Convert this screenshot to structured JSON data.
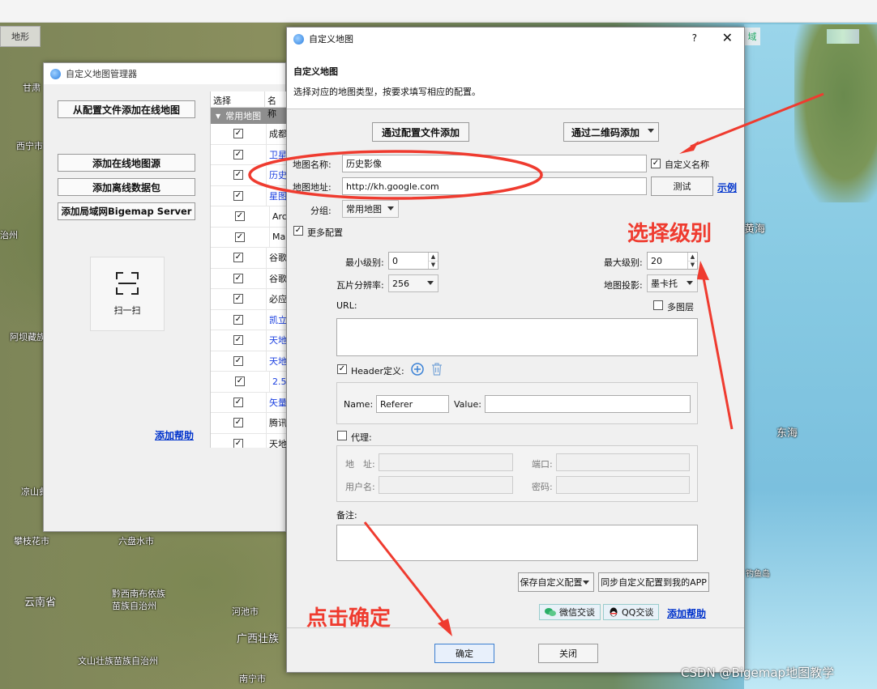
{
  "map": {
    "tab_left": "地形",
    "tab_right": "域",
    "labels": [
      {
        "text": "甘肃"
      },
      {
        "text": "西宁市"
      },
      {
        "text": "治州"
      },
      {
        "text": "阿坝藏族"
      },
      {
        "text": "凉山彝"
      },
      {
        "text": "攀枝花市"
      },
      {
        "text": "六盘水市"
      },
      {
        "text": "云南省"
      },
      {
        "text": "黔西南布依族苗族自治州"
      },
      {
        "text": "河池市"
      },
      {
        "text": "广西壮族"
      },
      {
        "text": "文山壮族苗族自治州"
      },
      {
        "text": "南宁市"
      },
      {
        "text": "黄海"
      },
      {
        "text": "东海"
      },
      {
        "text": "钓鱼岛"
      }
    ],
    "watermark": "CSDN @Bigemap地图教学"
  },
  "manager": {
    "title": "自定义地图管理器",
    "btn_add_from_config": "从配置文件添加在线地图",
    "btn_add_online": "添加在线地图源",
    "btn_add_offline": "添加离线数据包",
    "btn_add_lan": "添加局域网Bigemap Server",
    "scan_label": "扫一扫",
    "help_link": "添加帮助",
    "table": {
      "col_select": "选择",
      "col_name": "名称",
      "group": "常用地图",
      "rows": [
        {
          "name": "成都"
        },
        {
          "name": "卫星"
        },
        {
          "name": "历史"
        },
        {
          "name": "星图"
        },
        {
          "name": "Arc"
        },
        {
          "name": "Ma"
        },
        {
          "name": "谷歌"
        },
        {
          "name": "谷歌"
        },
        {
          "name": "必应"
        },
        {
          "name": "凯立"
        },
        {
          "name": "天地"
        },
        {
          "name": "天地"
        },
        {
          "name": "2.5"
        },
        {
          "name": "矢量"
        },
        {
          "name": "腾讯"
        },
        {
          "name": "天地"
        }
      ]
    }
  },
  "dialog": {
    "title": "自定义地图",
    "help_glyph": "?",
    "close_glyph": "✕",
    "header_title": "自定义地图",
    "header_desc": "选择对应的地图类型，按要求填写相应的配置。",
    "btn_add_by_config": "通过配置文件添加",
    "btn_add_by_qr": "通过二维码添加",
    "label_map_name": "地图名称:",
    "value_map_name": "历史影像",
    "check_custom_name": "自定义名称",
    "label_map_url": "地图地址:",
    "value_map_url": "http://kh.google.com",
    "btn_test": "测试",
    "link_example": "示例",
    "label_group": "分组:",
    "value_group": "常用地图",
    "check_more_config": "更多配置",
    "label_min_level": "最小级别:",
    "value_min_level": "0",
    "label_max_level": "最大级别:",
    "value_max_level": "20",
    "label_tile_res": "瓦片分辨率:",
    "value_tile_res": "256",
    "label_projection": "地图投影:",
    "value_projection": "墨卡托",
    "label_url": "URL:",
    "check_multilayer": "多图层",
    "check_header": "Header定义:",
    "label_hname": "Name:",
    "value_hname": "Referer",
    "label_hvalue": "Value:",
    "value_hvalue": "",
    "check_proxy": "代理:",
    "label_addr": "地　址:",
    "label_port": "端口:",
    "label_user": "用户名:",
    "label_pwd": "密码:",
    "label_note": "备注:",
    "btn_save_custom": "保存自定义配置",
    "btn_sync_app": "同步自定义配置到我的APP",
    "chip_wechat": "微信交谈",
    "chip_qq": "QQ交谈",
    "link_help": "添加帮助",
    "btn_ok": "确定",
    "btn_close": "关闭"
  },
  "annotations": {
    "select_level": "选择级别",
    "click_ok": "点击确定",
    "color": "#ef3b2f"
  }
}
